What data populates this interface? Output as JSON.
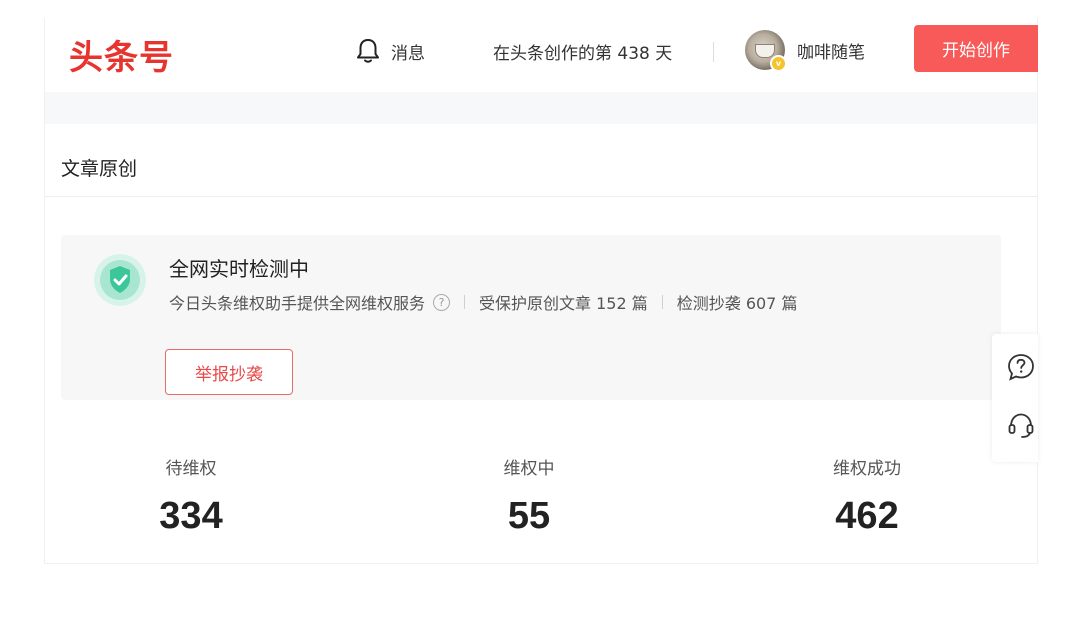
{
  "header": {
    "logo": "头条号",
    "messages_label": "消息",
    "days_text": "在头条创作的第 438 天",
    "username": "咖啡随笔",
    "start_button": "开始创作"
  },
  "section": {
    "title": "文章原创"
  },
  "monitor": {
    "title": "全网实时检测中",
    "service_text": "今日头条维权助手提供全网维权服务",
    "protected_text": "受保护原创文章 152 篇",
    "detected_text": "检测抄袭 607 篇",
    "report_button": "举报抄袭"
  },
  "stats": [
    {
      "label": "待维权",
      "value": "334"
    },
    {
      "label": "维权中",
      "value": "55"
    },
    {
      "label": "维权成功",
      "value": "462"
    }
  ],
  "colors": {
    "brand_red": "#e8342e",
    "button_red": "#f85959",
    "shield_green": "#3cc79b"
  },
  "icons": {
    "bell": "bell-icon",
    "help": "help-icon",
    "shield": "shield-check-icon",
    "question_bubble": "question-bubble-icon",
    "headset": "headset-icon"
  }
}
